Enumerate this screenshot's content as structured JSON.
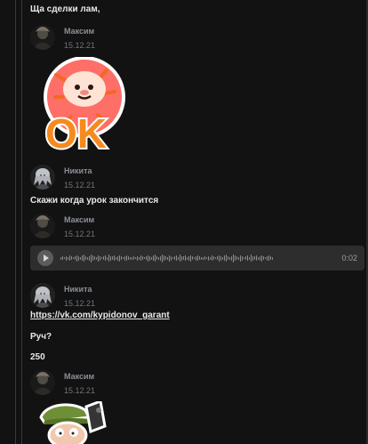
{
  "messages": {
    "m1_text": "Ща сделки лам,",
    "m2": {
      "author": "Максим",
      "date": "15.12.21"
    },
    "m3": {
      "author": "Никита",
      "date": "15.12.21",
      "text": "Скажи когда урок закончится"
    },
    "m4": {
      "author": "Максим",
      "date": "15.12.21",
      "duration": "0:02"
    },
    "m5": {
      "author": "Никита",
      "date": "15.12.21",
      "link": "https://vk.com/kypidonov_garant",
      "text2": "Руч?",
      "text3": "250"
    },
    "m6": {
      "author": "Максим",
      "date": "15.12.21"
    }
  },
  "stickers": {
    "ok_text": "OK"
  },
  "colors": {
    "background": "#121212",
    "text": "#e8e8e8",
    "muted": "#8a8f96",
    "audio_bg": "#2d2d2e",
    "tiger_orange": "#f06a25",
    "tiger_pink": "#ff6f68",
    "ok_orange": "#f58a1f"
  },
  "icons": {
    "play": "play-icon",
    "tiger": "tiger-sticker",
    "man": "man-sticker"
  }
}
